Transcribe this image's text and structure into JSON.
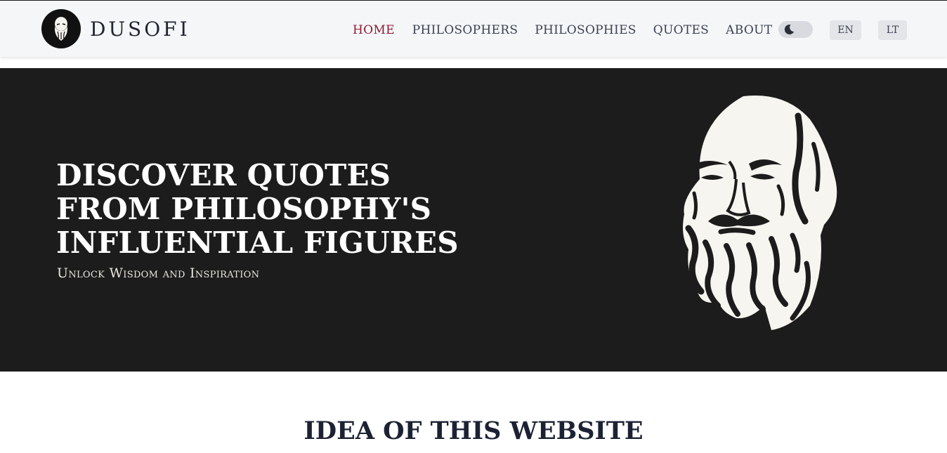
{
  "brand": {
    "name": "DUSOFI",
    "logo_icon": "philosopher-portrait-icon"
  },
  "nav": {
    "items": [
      {
        "label": "HOME",
        "active": true
      },
      {
        "label": "PHILOSOPHERS",
        "active": false
      },
      {
        "label": "PHILOSOPHIES",
        "active": false
      },
      {
        "label": "QUOTES",
        "active": false
      },
      {
        "label": "ABOUT",
        "active": false
      }
    ],
    "theme_toggle_icon": "moon-icon",
    "languages": [
      "EN",
      "LT"
    ]
  },
  "hero": {
    "title_lines": [
      "DISCOVER QUOTES",
      "FROM PHILOSOPHY'S",
      "INFLUENTIAL FIGURES"
    ],
    "subtitle": "Unlock Wisdom and Inspiration",
    "image_icon": "socrates-portrait-icon"
  },
  "section": {
    "title": "IDEA OF THIS WEBSITE"
  },
  "colors": {
    "accent": "#8e1b32",
    "hero_bg": "#1c1c1c",
    "header_bg": "#f5f6f8",
    "text_dark": "#1c2233",
    "portrait": "#f7f5f0"
  }
}
